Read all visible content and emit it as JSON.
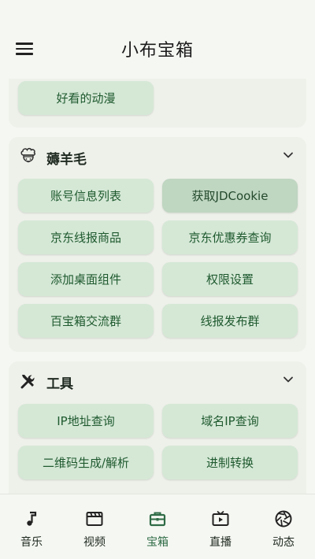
{
  "header": {
    "title": "小布宝箱"
  },
  "sections": {
    "top": {
      "items": [
        "好看的动漫"
      ]
    },
    "wool": {
      "title": "薅羊毛",
      "items": [
        "账号信息列表",
        "获取JDCookie",
        "京东线报商品",
        "京东优惠券查询",
        "添加桌面组件",
        "权限设置",
        "百宝箱交流群",
        "线报发布群"
      ]
    },
    "tools": {
      "title": "工具",
      "items": [
        "IP地址查询",
        "域名IP查询",
        "二维码生成/解析",
        "进制转换"
      ]
    }
  },
  "bottom_nav": {
    "items": [
      {
        "label": "音乐",
        "icon": "music-note-icon"
      },
      {
        "label": "视频",
        "icon": "film-icon"
      },
      {
        "label": "宝箱",
        "icon": "toolbox-icon"
      },
      {
        "label": "直播",
        "icon": "tv-icon"
      },
      {
        "label": "动态",
        "icon": "aperture-icon"
      }
    ],
    "selected_index": 2
  },
  "colors": {
    "accent": "#2e6b45",
    "button_bg": "#d5e8d6",
    "card_bg": "#eef1ea"
  }
}
